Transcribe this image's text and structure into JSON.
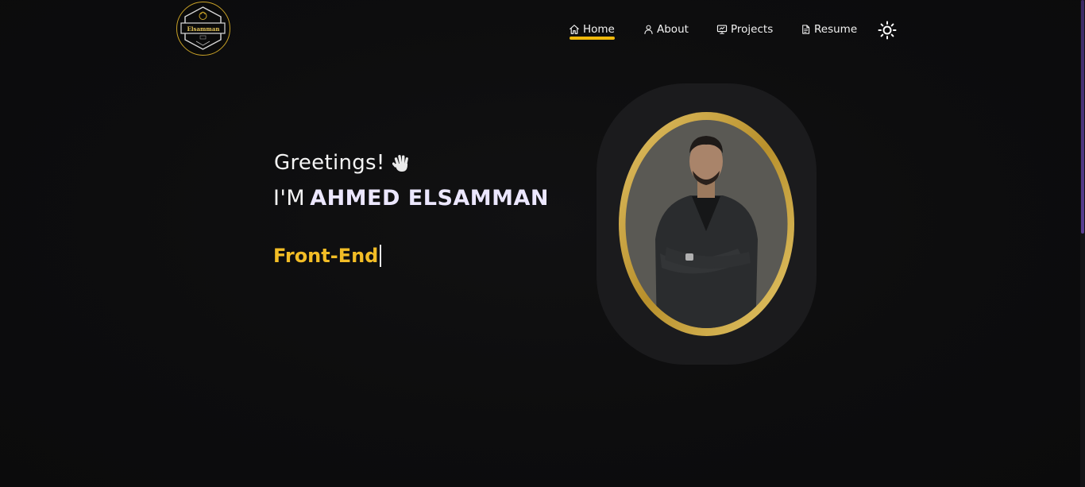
{
  "brand": {
    "logo_text": "Elsamman",
    "logo_icon": "badge-logo-icon"
  },
  "nav": {
    "items": [
      {
        "label": "Home",
        "icon": "home-icon",
        "active": true
      },
      {
        "label": "About",
        "icon": "user-icon",
        "active": false
      },
      {
        "label": "Projects",
        "icon": "monitor-icon",
        "active": false
      },
      {
        "label": "Resume",
        "icon": "document-icon",
        "active": false
      }
    ],
    "theme_toggle_icon": "sun-icon"
  },
  "hero": {
    "greeting": "Greetings!",
    "intro_prefix": "I'M",
    "name": "AHMED ELSAMMAN",
    "typed_text": "Front-End"
  },
  "colors": {
    "accent": "#f0b90b",
    "typed_text": "#f2bd26",
    "background": "#0c0c0d",
    "card": "#1b1b1d",
    "frame_gold": "#c9a227"
  }
}
